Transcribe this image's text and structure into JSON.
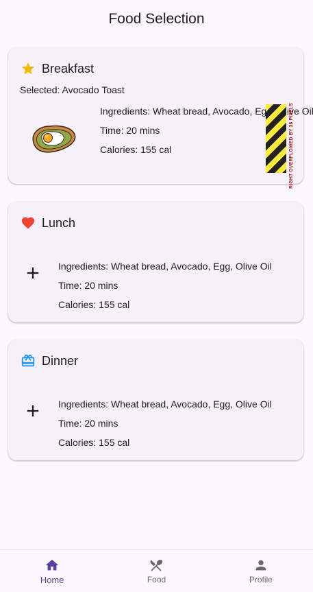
{
  "app": {
    "title": "Food Selection"
  },
  "meals": [
    {
      "title": "Breakfast",
      "icon": "star-icon",
      "icon_color": "#f9b800",
      "selected": "Selected: Avocado Toast",
      "image": "avocado-toast-egg-image",
      "ingredients": "Ingredients: Wheat bread, Avocado, Egg, Olive Oil",
      "time": "Time: 20 mins",
      "calories": "Calories: 155 cal",
      "overflow_warning": "RIGHT OVERFLOWED BY 36 PIXELS"
    },
    {
      "title": "Lunch",
      "icon": "heart-icon",
      "icon_color": "#f44336",
      "action_icon": "add-icon",
      "ingredients": "Ingredients: Wheat bread, Avocado, Egg, Olive Oil",
      "time": "Time: 20 mins",
      "calories": "Calories: 155 cal"
    },
    {
      "title": "Dinner",
      "icon": "cake-icon",
      "icon_color": "#2196f3",
      "action_icon": "add-icon",
      "ingredients": "Ingredients: Wheat bread, Avocado, Egg, Olive Oil",
      "time": "Time: 20 mins",
      "calories": "Calories: 155 cal"
    }
  ],
  "nav": {
    "items": [
      {
        "label": "Home",
        "icon": "home-icon",
        "active": true
      },
      {
        "label": "Food",
        "icon": "restaurant-icon",
        "active": false
      },
      {
        "label": "Profile",
        "icon": "person-icon",
        "active": false
      }
    ],
    "active_color": "#5b3fa3",
    "inactive_color": "#6b6770"
  }
}
